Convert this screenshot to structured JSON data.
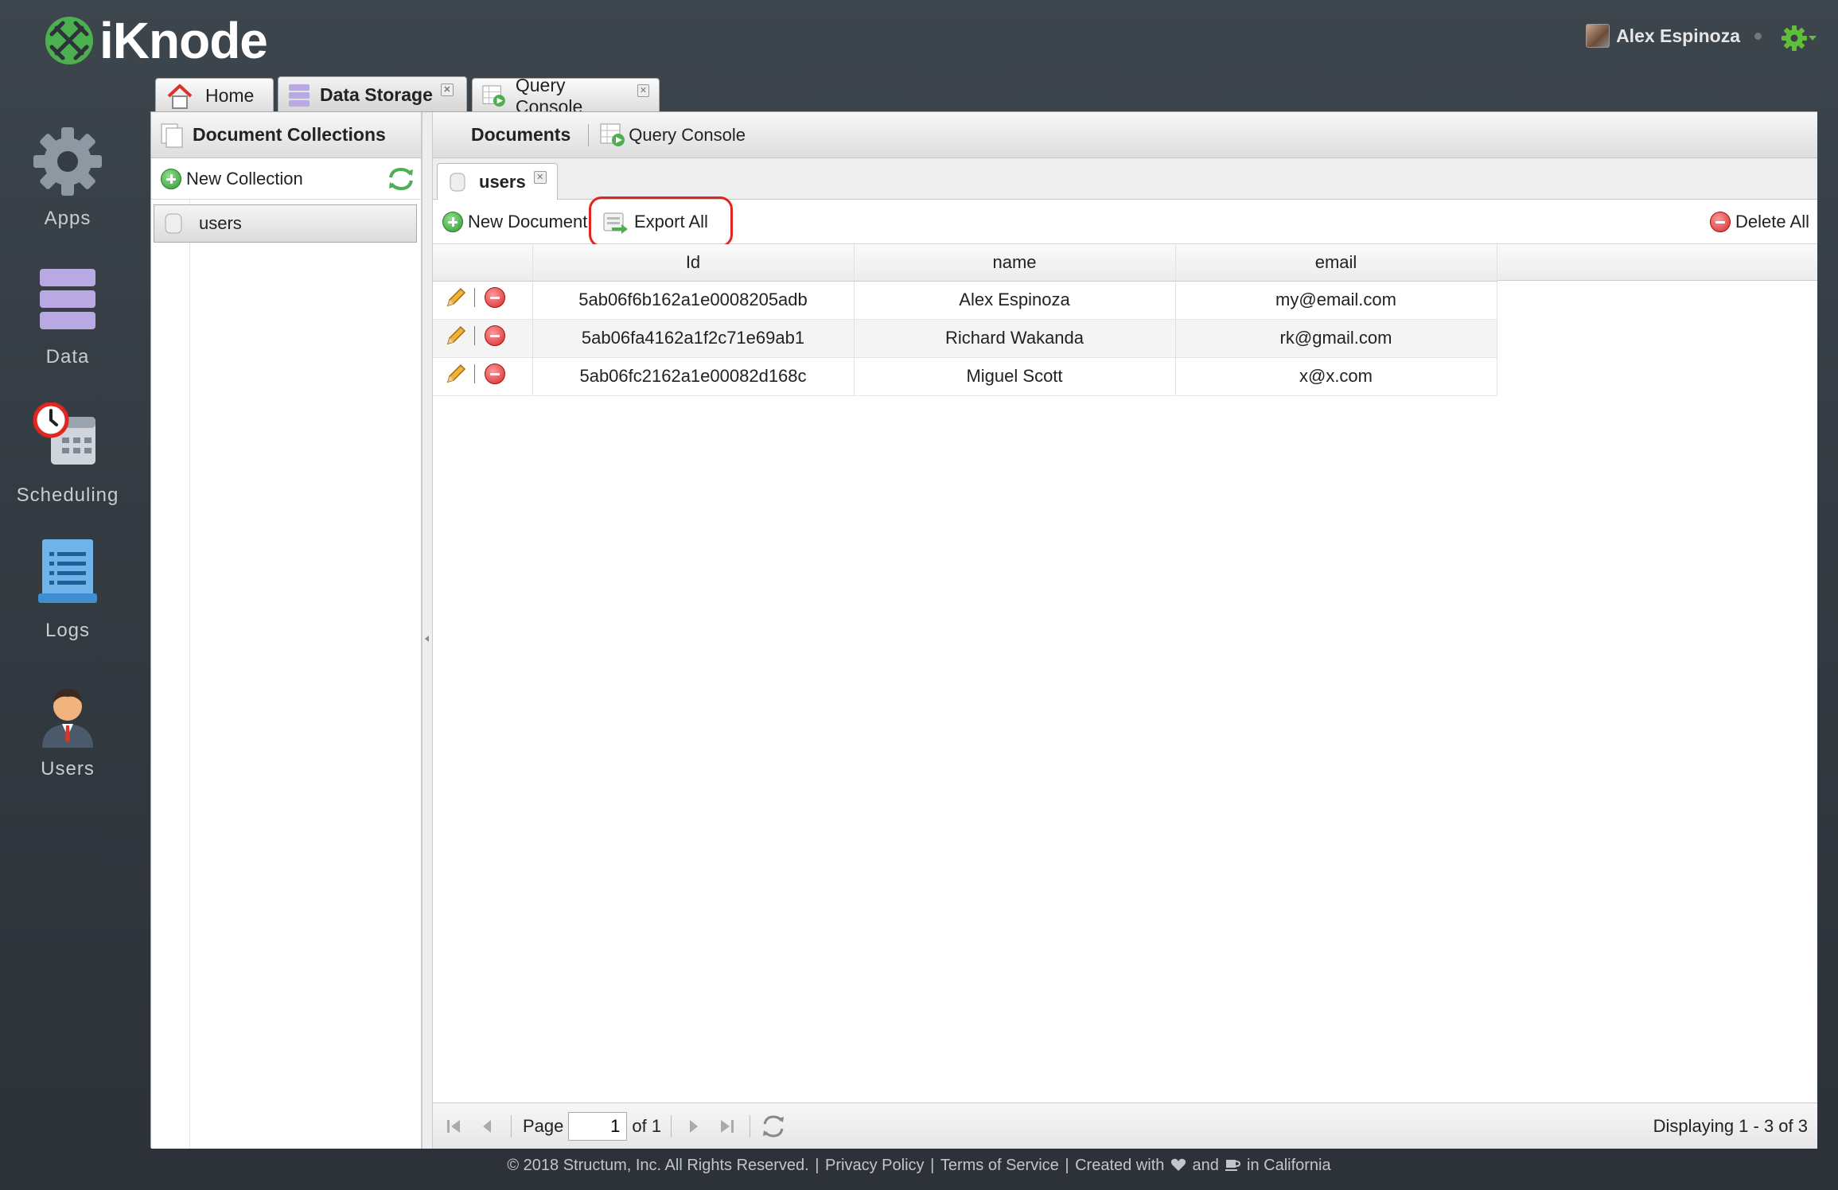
{
  "app": {
    "name": "iKnode"
  },
  "user": {
    "name": "Alex Espinoza"
  },
  "nav": [
    {
      "label": "Apps",
      "icon": "gear-icon"
    },
    {
      "label": "Data",
      "icon": "database-icon"
    },
    {
      "label": "Scheduling",
      "icon": "clock-calendar-icon"
    },
    {
      "label": "Logs",
      "icon": "log-document-icon"
    },
    {
      "label": "Users",
      "icon": "user-icon"
    }
  ],
  "top_tabs": [
    {
      "label": "Home",
      "icon": "home-icon"
    },
    {
      "label": "Data Storage",
      "icon": "database-icon"
    },
    {
      "label": "Query Console",
      "icon": "query-console-icon"
    }
  ],
  "collections_panel": {
    "title": "Document Collections",
    "new_label": "New Collection",
    "items": [
      "users"
    ]
  },
  "documents_panel": {
    "title": "Documents",
    "query_console_label": "Query Console",
    "tab_label": "users",
    "new_document_label": "New Document",
    "export_all_label": "Export All",
    "delete_all_label": "Delete All"
  },
  "grid": {
    "columns": [
      "Id",
      "name",
      "email"
    ],
    "rows": [
      {
        "id": "5ab06f6b162a1e0008205adb",
        "name": "Alex Espinoza",
        "email": "my@email.com"
      },
      {
        "id": "5ab06fa4162a1f2c71e69ab1",
        "name": "Richard Wakanda",
        "email": "rk@gmail.com"
      },
      {
        "id": "5ab06fc2162a1e00082d168c",
        "name": "Miguel Scott",
        "email": "x@x.com"
      }
    ]
  },
  "pager": {
    "page_label": "Page",
    "page_value": "1",
    "of_label": "of 1",
    "displaying": "Displaying 1 - 3 of 3"
  },
  "footer": {
    "copyright": "© 2018 Structum, Inc. All Rights Reserved.",
    "privacy": "Privacy Policy",
    "terms": "Terms of Service",
    "created_with": "Created with",
    "and": "and",
    "in_california": "in California"
  },
  "colors": {
    "accent_green": "#5cb85c",
    "highlight_red": "#e0261f"
  }
}
